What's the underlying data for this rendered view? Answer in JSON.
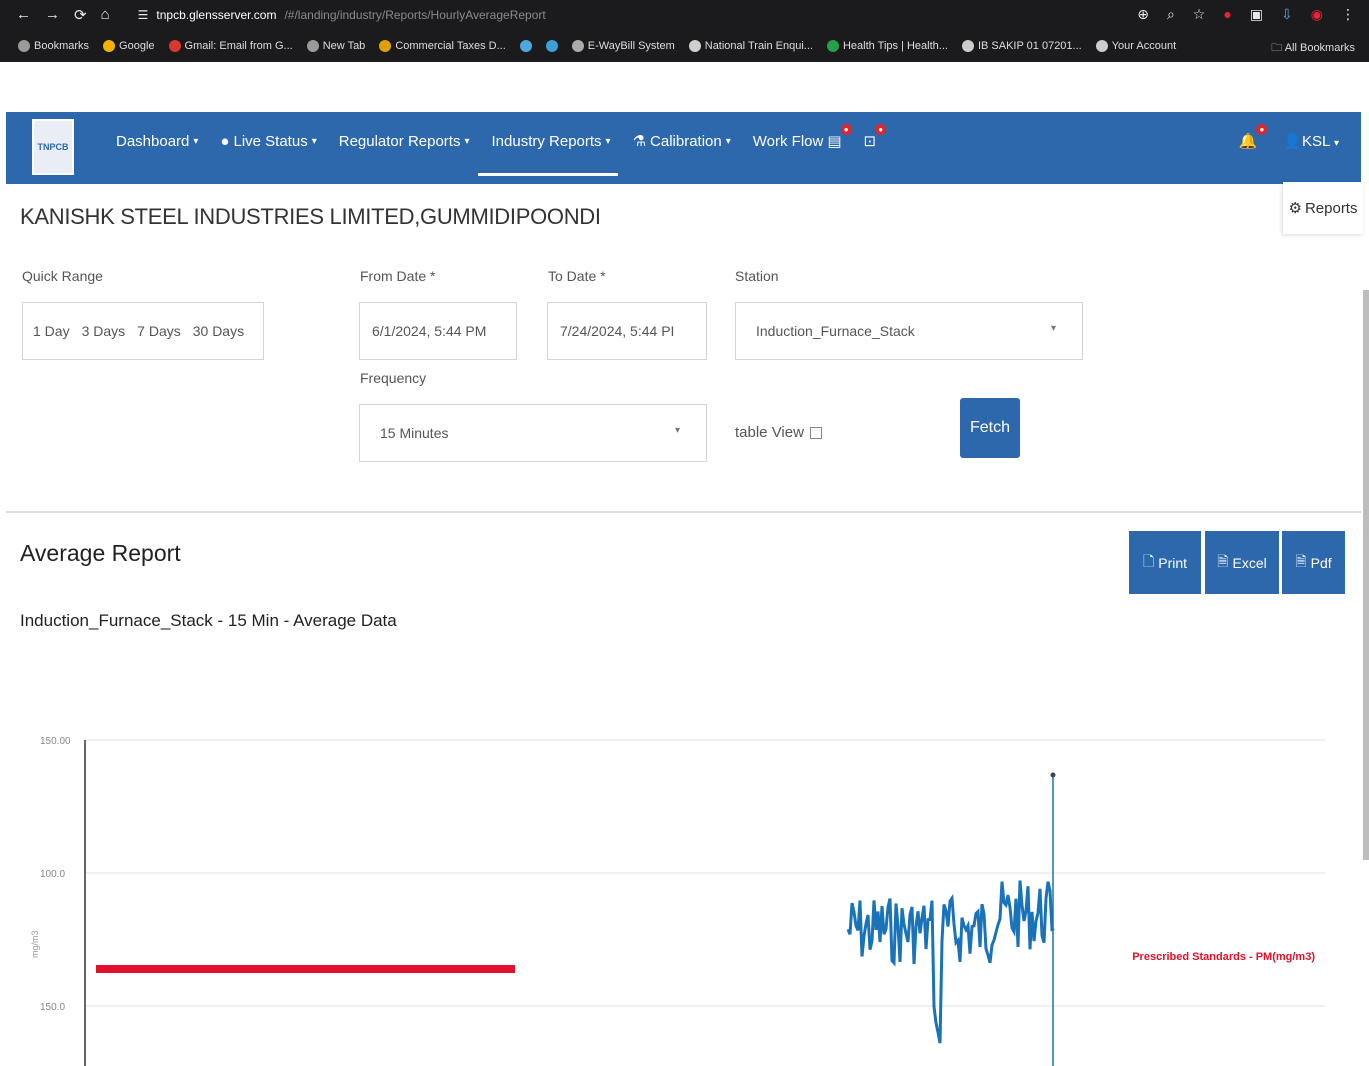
{
  "browser": {
    "nav": [
      "←",
      "→",
      "⟳",
      "⌂"
    ],
    "url_host": "tnpcb.glensserver.com",
    "url_path": "/#/landing/industry/Reports/HourlyAverageReport",
    "bookmarks": [
      {
        "label": "Bookmarks",
        "color": "#9a9a9a"
      },
      {
        "label": "Google",
        "color": "#f2b400"
      },
      {
        "label": "Gmail: Email from G...",
        "color": "#d9382f"
      },
      {
        "label": "New Tab",
        "color": "#9a9a9a"
      },
      {
        "label": "Commercial Taxes D...",
        "color": "#e0a000"
      },
      {
        "label": "",
        "color": "#4ea8e0"
      },
      {
        "label": "",
        "color": "#3aa0d8"
      },
      {
        "label": "E-WayBill System",
        "color": "#aaaaaa"
      },
      {
        "label": "National Train Enqui...",
        "color": "#cfcfcf"
      },
      {
        "label": "Health Tips | Health...",
        "color": "#26a14a"
      },
      {
        "label": "IB SAKIP 01 07201...",
        "color": "#cccccc"
      },
      {
        "label": "Your Account",
        "color": "#cccccc"
      }
    ],
    "all_bookmarks": "All Bookmarks"
  },
  "navbar": {
    "logo": "TNPCB",
    "menu": [
      {
        "label": "Dashboard",
        "caret": true
      },
      {
        "label": "Live Status",
        "caret": true
      },
      {
        "label": "Regulator Reports",
        "caret": true
      },
      {
        "label": "Industry Reports",
        "caret": true
      },
      {
        "label": "Calibration",
        "caret": true
      },
      {
        "label": "Work Flow",
        "caret": false
      }
    ],
    "user": "KSL"
  },
  "page": {
    "reports_link": "Reports",
    "company": "KANISHK STEEL INDUSTRIES LIMITED,GUMMIDIPOONDI",
    "quick_range_label": "Quick Range",
    "quick_options": [
      "1 Day",
      "3 Days",
      "7 Days",
      "30 Days"
    ],
    "from_label": "From Date *",
    "from_value": "6/1/2024, 5:44 PM",
    "to_label": "To Date *",
    "to_value": "7/24/2024, 5:44 PI",
    "station_label": "Station",
    "station_value": "Induction_Furnace_Stack",
    "frequency_label": "Frequency",
    "frequency_value": "15 Minutes",
    "table_view_label": "table View",
    "fetch_label": "Fetch"
  },
  "report": {
    "title": "Average Report",
    "print": "Print",
    "excel": "Excel",
    "pdf": "Pdf",
    "subtitle": "Induction_Furnace_Stack - 15 Min - Average Data"
  },
  "chart_data": {
    "type": "line",
    "y_ticks": [
      "150.00",
      "100.0",
      "150.0"
    ],
    "ylabel": "mg/m3",
    "standard_label": "Prescribed Standards - PM(mg/m3)",
    "grid": true,
    "standard_color": "#e0112b",
    "series_color": "#1a73b8",
    "legend": "right"
  }
}
